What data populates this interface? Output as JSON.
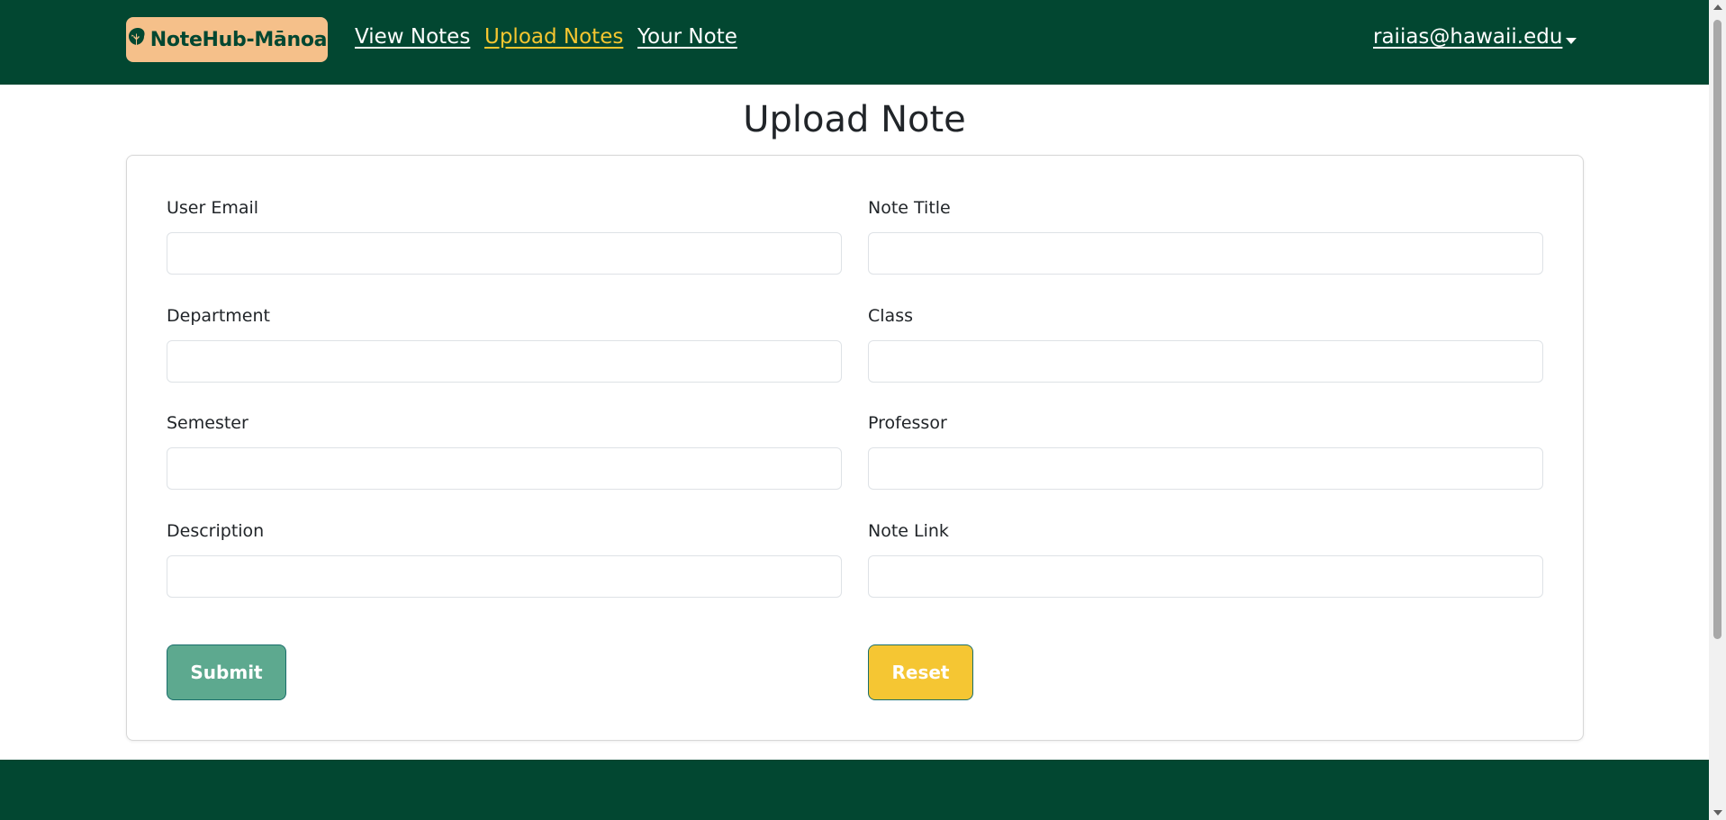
{
  "navbar": {
    "brand": "NoteHub-Mānoa",
    "brand_icon": "monstera-leaf-icon",
    "links": [
      {
        "label": "View Notes",
        "active": false
      },
      {
        "label": "Upload Notes",
        "active": true
      },
      {
        "label": "Your Note",
        "active": false
      }
    ],
    "user_email": "raiias@hawaii.edu",
    "colors": {
      "background": "#024731",
      "brand_bg": "#f5c08a",
      "active_link": "#f6c630"
    }
  },
  "page": {
    "title": "Upload Note"
  },
  "form": {
    "fields": {
      "user_email": {
        "label": "User Email",
        "value": ""
      },
      "note_title": {
        "label": "Note Title",
        "value": ""
      },
      "department": {
        "label": "Department",
        "value": ""
      },
      "class": {
        "label": "Class",
        "value": ""
      },
      "semester": {
        "label": "Semester",
        "value": ""
      },
      "professor": {
        "label": "Professor",
        "value": ""
      },
      "description": {
        "label": "Description",
        "value": ""
      },
      "note_link": {
        "label": "Note Link",
        "value": ""
      }
    },
    "submit_label": "Submit",
    "reset_label": "Reset",
    "colors": {
      "submit": "#5da98f",
      "reset": "#f5c633"
    }
  }
}
